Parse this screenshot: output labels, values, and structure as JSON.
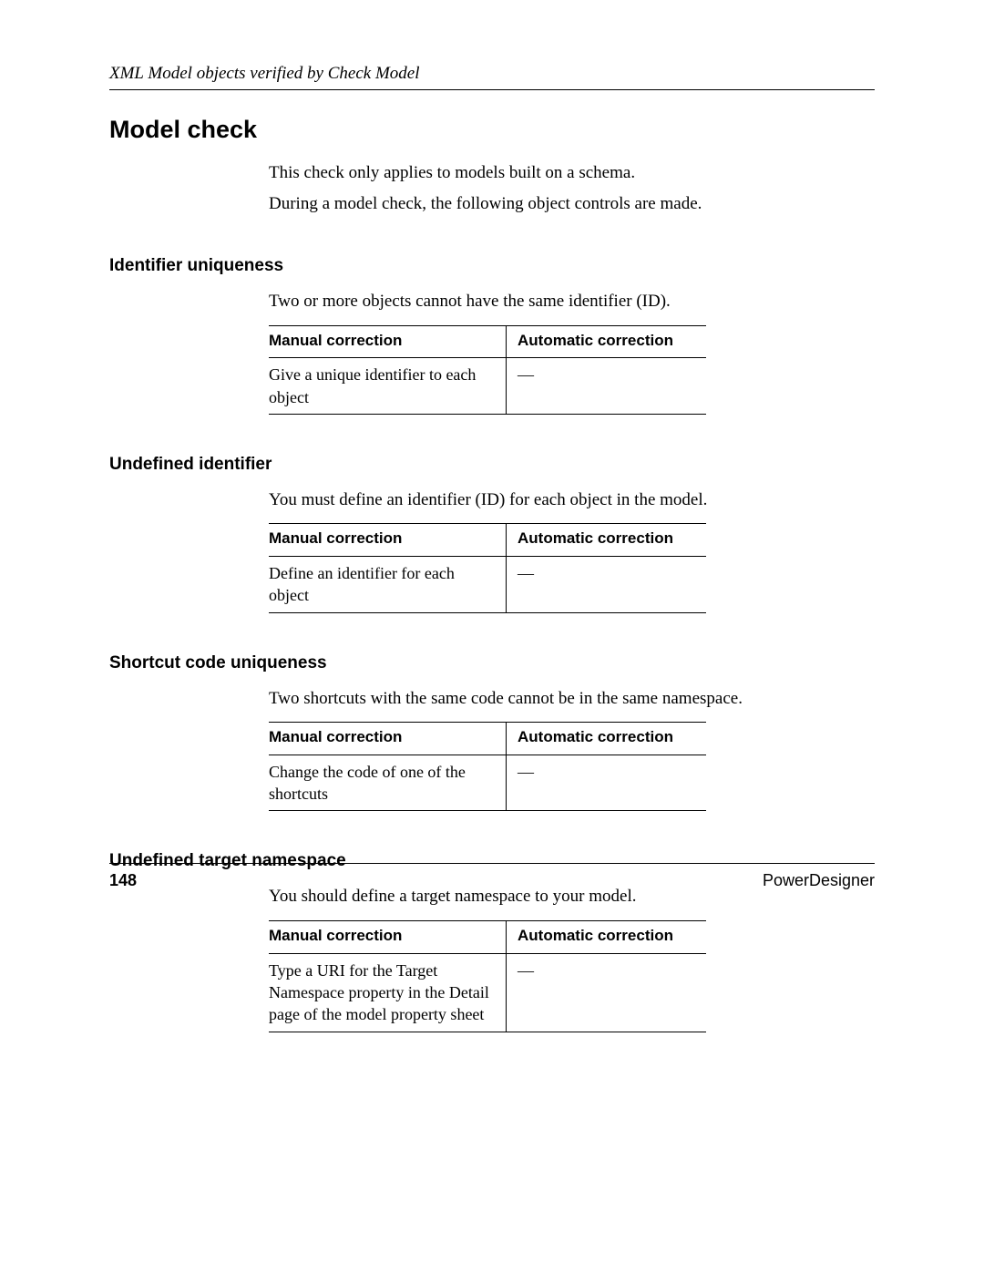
{
  "header": {
    "running": "XML Model objects verified by Check Model"
  },
  "title": "Model check",
  "intro": {
    "p1": "This check only applies to models built on a schema.",
    "p2": "During a model check, the following object controls are made."
  },
  "table_headers": {
    "manual": "Manual correction",
    "auto": "Automatic correction"
  },
  "sections": [
    {
      "title": "Identifier uniqueness",
      "desc": "Two or more objects cannot have the same identifier (ID).",
      "manual": "Give a unique identifier to each object",
      "auto": "—"
    },
    {
      "title": "Undefined identifier",
      "desc": "You must define an identifier (ID) for each object in the model.",
      "manual": "Define an identifier for each object",
      "auto": "—"
    },
    {
      "title": "Shortcut code uniqueness",
      "desc": "Two shortcuts with the same code cannot be in the same namespace.",
      "manual": "Change the code of one of the shortcuts",
      "auto": "—"
    },
    {
      "title": "Undefined target namespace",
      "desc": "You should define a target namespace to your model.",
      "manual": "Type a URI for the Target Namespace property in the Detail page of the model property sheet",
      "auto": "—"
    }
  ],
  "footer": {
    "page": "148",
    "brand": "PowerDesigner"
  }
}
